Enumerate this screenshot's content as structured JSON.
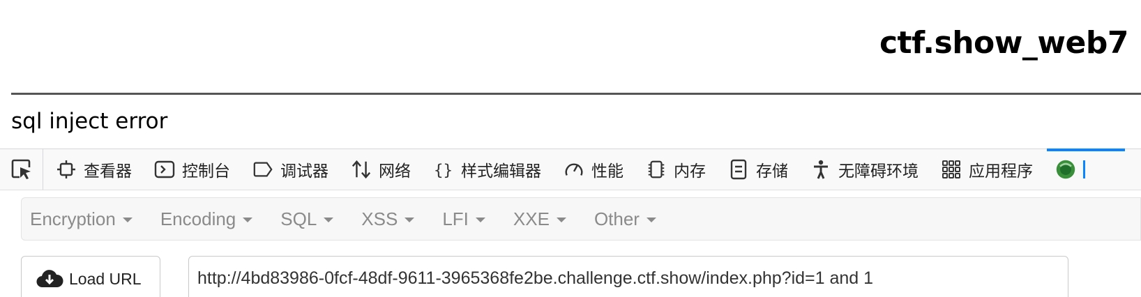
{
  "page": {
    "title": "ctf.show_web7",
    "message": "sql inject error"
  },
  "devtools": {
    "tabs": [
      {
        "label": "查看器",
        "icon": "inspector-icon"
      },
      {
        "label": "控制台",
        "icon": "console-icon"
      },
      {
        "label": "调试器",
        "icon": "debugger-icon"
      },
      {
        "label": "网络",
        "icon": "network-icon"
      },
      {
        "label": "样式编辑器",
        "icon": "style-editor-icon"
      },
      {
        "label": "性能",
        "icon": "performance-icon"
      },
      {
        "label": "内存",
        "icon": "memory-icon"
      },
      {
        "label": "存储",
        "icon": "storage-icon"
      },
      {
        "label": "无障碍环境",
        "icon": "accessibility-icon"
      },
      {
        "label": "应用程序",
        "icon": "application-icon"
      }
    ],
    "active_accent": "#0a84ff"
  },
  "hackbar": {
    "menu": [
      "Encryption",
      "Encoding",
      "SQL",
      "XSS",
      "LFI",
      "XXE",
      "Other"
    ],
    "load_url_label": "Load URL",
    "url_value": "http://4bd83986-0fcf-48df-9611-3965368fe2be.challenge.ctf.show/index.php?id=1 and 1"
  }
}
